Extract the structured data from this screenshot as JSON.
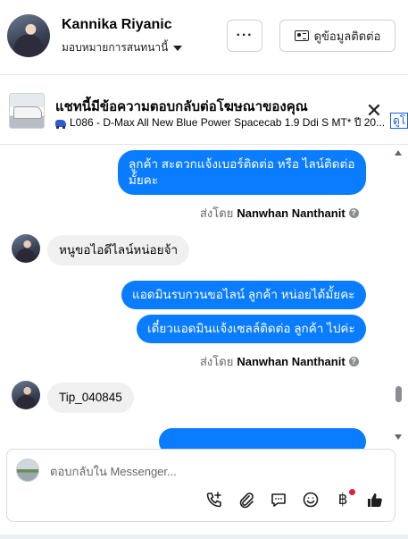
{
  "header": {
    "contact_name": "Kannika Riyanic",
    "assigned_label": "มอบหมายการสนทนานี้",
    "more_label": "···",
    "contact_info_label": "ดูข้อมูลติดต่อ"
  },
  "ad_banner": {
    "title": "แชทนี้มีข้อความตอบกลับต่อโฆษณาของคุณ",
    "ad_text": "L086 - D-Max All New Blue Power Spacecab 1.9 Ddi S MT* ปี 20...",
    "close_label": "✕",
    "see_label": "ดูโ"
  },
  "messages": [
    {
      "direction": "out",
      "text": "ลูกค้า สะดวกแจ้งเบอร์ติดต่อ หรือ ไลน์ติดต่อ มั้ยคะ"
    },
    {
      "sender_prefix": "ส่งโดย",
      "sender_name": "Nanwhan Nanthanit"
    },
    {
      "direction": "in",
      "text": "หนูขอไอดีไลน์หน่อยจ้า"
    },
    {
      "direction": "out",
      "text": "แอดมินรบกวนขอไลน์  ลูกค้า  หน่อยได้มั้ยคะ"
    },
    {
      "direction": "out",
      "text": "เดี๋ยวแอดมินแจ้งเซลล์ติดต่อ ลูกค้า  ไปค่ะ"
    },
    {
      "sender_prefix": "ส่งโดย",
      "sender_name": "Nanwhan Nanthanit"
    },
    {
      "direction": "in",
      "text": "Tip_040845"
    }
  ],
  "composer": {
    "placeholder": "ตอบกลับใน Messenger...",
    "icons": [
      "phone-plus-icon",
      "paperclip-icon",
      "saved-reply-icon",
      "emoji-icon",
      "baht-payment-icon",
      "like-icon"
    ],
    "baht_symbol": "฿"
  },
  "colors": {
    "outgoing_bubble": "#0a7cff",
    "incoming_bubble": "#f0f0f0",
    "link_blue": "#1a5be5",
    "notification_dot": "#e41e3f"
  }
}
